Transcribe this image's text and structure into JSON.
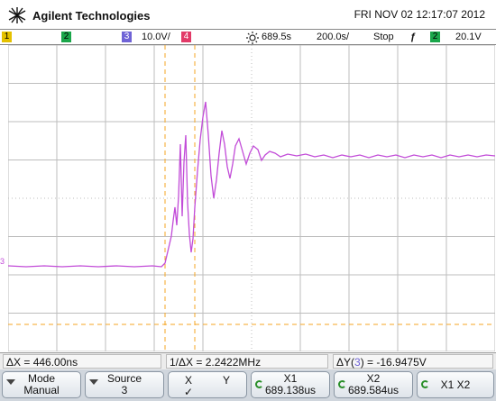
{
  "header": {
    "brand": "Agilent Technologies",
    "datetime": "FRI NOV 02 12:17:07 2012"
  },
  "status_bar": {
    "ch1_label": "1",
    "ch2_label": "2",
    "ch3_label": "3",
    "ch3_scale": "10.0V/",
    "ch4_label": "4",
    "trigger_position": "689.5",
    "timebase": "200.0",
    "run_state": "Stop",
    "trigger_source": "2",
    "trigger_level": "20.1V"
  },
  "plot": {
    "ch3_marker": "3",
    "colors": {
      "trace": "#c24cd8",
      "cursor": "#f5a623",
      "grid": "#bdbdbd",
      "ch1": "#e5c100",
      "ch2": "#1aa64a",
      "ch3": "#6f63d6",
      "ch4": "#e23a68"
    }
  },
  "measure_bar": {
    "delta_x": "ΔX = 446.00ns",
    "inv_delta_x": "1/ΔX = 2.2422MHz",
    "delta_y_prefix": "ΔY(",
    "delta_y_ch": "3",
    "delta_y_suffix": ") = -16.9475V"
  },
  "softkeys": {
    "mode": {
      "top": "Mode",
      "bottom": "Manual"
    },
    "source": {
      "top": "Source",
      "bottom": "3"
    },
    "xy": {
      "x": "X",
      "y": "Y",
      "check": "✓"
    },
    "x1": {
      "top": "X1",
      "bottom": "689.138us"
    },
    "x2": {
      "top": "X2",
      "bottom": "689.584us"
    },
    "x1x2": {
      "label": "X1 X2"
    }
  }
}
